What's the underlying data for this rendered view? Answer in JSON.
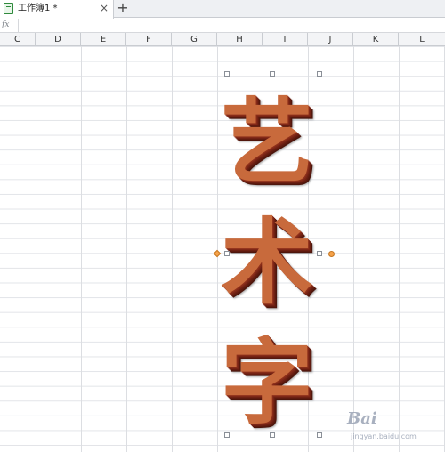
{
  "tabbar": {
    "tab_label": "工作簿1 *",
    "close_symbol": "×",
    "new_tab_symbol": "+"
  },
  "formula_bar": {
    "fx_label": "fx",
    "value": ""
  },
  "columns": [
    "C",
    "D",
    "E",
    "F",
    "G",
    "H",
    "I",
    "J",
    "K",
    "L"
  ],
  "wordart": {
    "text": "艺术字",
    "chars": [
      "艺",
      "术",
      "字"
    ],
    "colors": {
      "face": "#c86a3c",
      "extrusion": "#6c1f12"
    }
  },
  "watermark": {
    "logo": "Bai",
    "text": "jingyan.baidu.com"
  }
}
